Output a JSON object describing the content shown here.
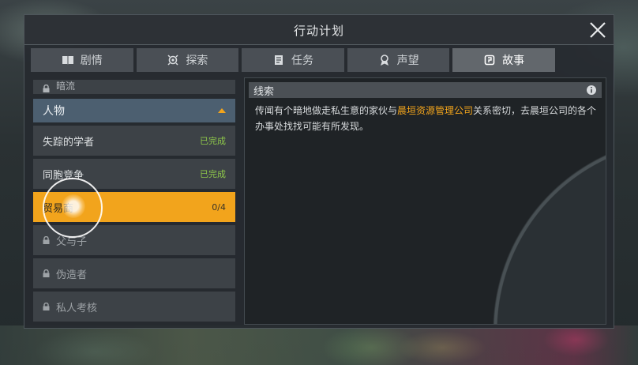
{
  "window": {
    "title": "行动计划"
  },
  "tabs": [
    {
      "label": "剧情",
      "icon": "book-icon"
    },
    {
      "label": "探索",
      "icon": "explore-icon"
    },
    {
      "label": "任务",
      "icon": "task-icon"
    },
    {
      "label": "声望",
      "icon": "reputation-icon"
    },
    {
      "label": "故事",
      "icon": "story-icon",
      "active": true
    }
  ],
  "list": {
    "partial_item": "暗流",
    "category": "人物",
    "items": [
      {
        "label": "失踪的学者",
        "status": "已完成"
      },
      {
        "label": "同胞竞争",
        "status": "已完成"
      },
      {
        "label": "贸易商",
        "status": "0/4"
      },
      {
        "label": "父与子",
        "status": ""
      },
      {
        "label": "伪造者",
        "status": ""
      },
      {
        "label": "私人考核",
        "status": ""
      }
    ]
  },
  "clue": {
    "heading": "线索",
    "text_before": "传闻有个暗地做走私生意的家伙与",
    "highlight": "晨垣资源管理公司",
    "text_after": "关系密切，去晨垣公司的各个办事处找找可能有所发现。"
  },
  "colors": {
    "accent": "#f2a41c",
    "completed": "#8fc94a",
    "category": "#4c5f70"
  }
}
